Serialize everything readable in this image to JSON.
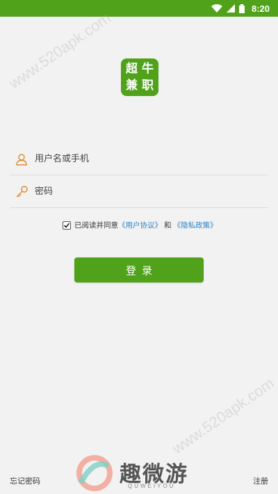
{
  "status_bar": {
    "time": "8:20"
  },
  "watermark": {
    "text": "www.520apk.com"
  },
  "logo": {
    "chars": [
      "超",
      "牛",
      "兼",
      "职"
    ]
  },
  "login_form": {
    "username_placeholder": "用户名或手机",
    "password_placeholder": "密码",
    "agreement": {
      "checked": true,
      "prefix": "已阅读并同意",
      "user_agreement": "《用户协议》",
      "and": "和",
      "privacy_policy": "《隐私政策》"
    },
    "login_button": "登录"
  },
  "footer": {
    "forgot_password": "忘记密码",
    "register": "注册",
    "brand_name": "趣微游",
    "brand_sub": "QUWEIYOU"
  },
  "colors": {
    "primary": "#4fa21a",
    "link": "#2b84c8",
    "background": "#f2f2f2"
  }
}
